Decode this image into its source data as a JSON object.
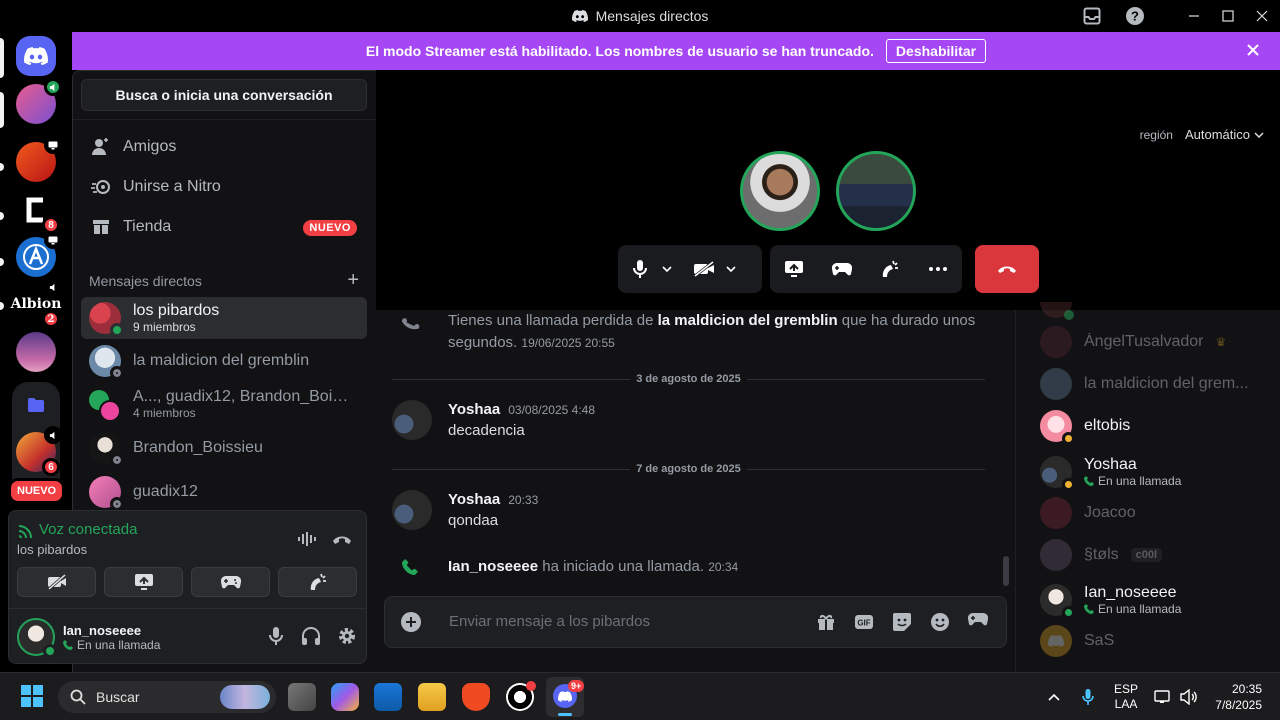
{
  "window": {
    "title": "Mensajes directos"
  },
  "banner": {
    "text": "El modo Streamer está habilitado. Los nombres de usuario se han truncado.",
    "button": "Deshabilitar"
  },
  "rail": {
    "badges": [
      "8",
      "2",
      "6"
    ],
    "new_label": "NUEVO"
  },
  "sidebar": {
    "search": "Busca o inicia una conversación",
    "nav": [
      {
        "label": "Amigos",
        "icon": "friends-icon"
      },
      {
        "label": "Unirse a Nitro",
        "icon": "nitro-icon"
      },
      {
        "label": "Tienda",
        "icon": "shop-icon",
        "badge": "NUEVO"
      }
    ],
    "dm_header": "Mensajes directos",
    "dms": [
      {
        "name": "los pibardos",
        "sub": "9 miembros",
        "active": true
      },
      {
        "name": "la maldicion del gremblin",
        "sub": ""
      },
      {
        "name": "A..., guadix12, Brandon_Boissi...",
        "sub": "4 miembros"
      },
      {
        "name": "Brandon_Boissieu",
        "sub": ""
      },
      {
        "name": "guadix12",
        "sub": ""
      }
    ]
  },
  "voice": {
    "status": "Voz conectada",
    "channel": "los pibardos"
  },
  "user": {
    "name": "Ian_noseeee",
    "status": "En una llamada"
  },
  "call": {
    "region_label": "región",
    "region_value": "Automático"
  },
  "chat": {
    "missed_prefix": "Tienes una llamada perdida de ",
    "missed_name": "la maldicion del gremblin",
    "missed_suffix": " que ha durado unos",
    "missed_line2": "segundos.",
    "missed_time": "19/06/2025 20:55",
    "date1": "3 de agosto de 2025",
    "msg1": {
      "author": "Yoshaa",
      "time": "03/08/2025 4:48",
      "body": "decadencia"
    },
    "date2": "7 de agosto de 2025",
    "msg2": {
      "author": "Yoshaa",
      "time": "20:33",
      "body": "qondaa"
    },
    "call_started": {
      "name": "Ian_noseeee",
      "text": " ha iniciado una llamada.",
      "time": "20:34"
    },
    "placeholder": "Enviar mensaje a los pibardos"
  },
  "members": [
    {
      "name": "ÁngelTusalvador",
      "sub": "",
      "dim": true,
      "crown": true
    },
    {
      "name": "la maldicion del grem...",
      "sub": "",
      "dim": true
    },
    {
      "name": "eltobis",
      "sub": "",
      "dim": false
    },
    {
      "name": "Yoshaa",
      "sub": "En una llamada",
      "dim": false
    },
    {
      "name": "Joacoo",
      "sub": "",
      "dim": true
    },
    {
      "name": "§tøls",
      "sub": "",
      "dim": true,
      "tag": "c00l"
    },
    {
      "name": "Ian_noseeee",
      "sub": "En una llamada",
      "dim": false
    },
    {
      "name": "SaS",
      "sub": "",
      "dim": true
    }
  ],
  "taskbar": {
    "search": "Buscar",
    "lang1": "ESP",
    "lang2": "LAA",
    "time": "20:35",
    "date": "7/8/2025",
    "discord_badge": "9+"
  },
  "colors": {
    "banner": "#a547f5",
    "online": "#23a55a",
    "danger": "#da373c",
    "background": "#121214"
  }
}
